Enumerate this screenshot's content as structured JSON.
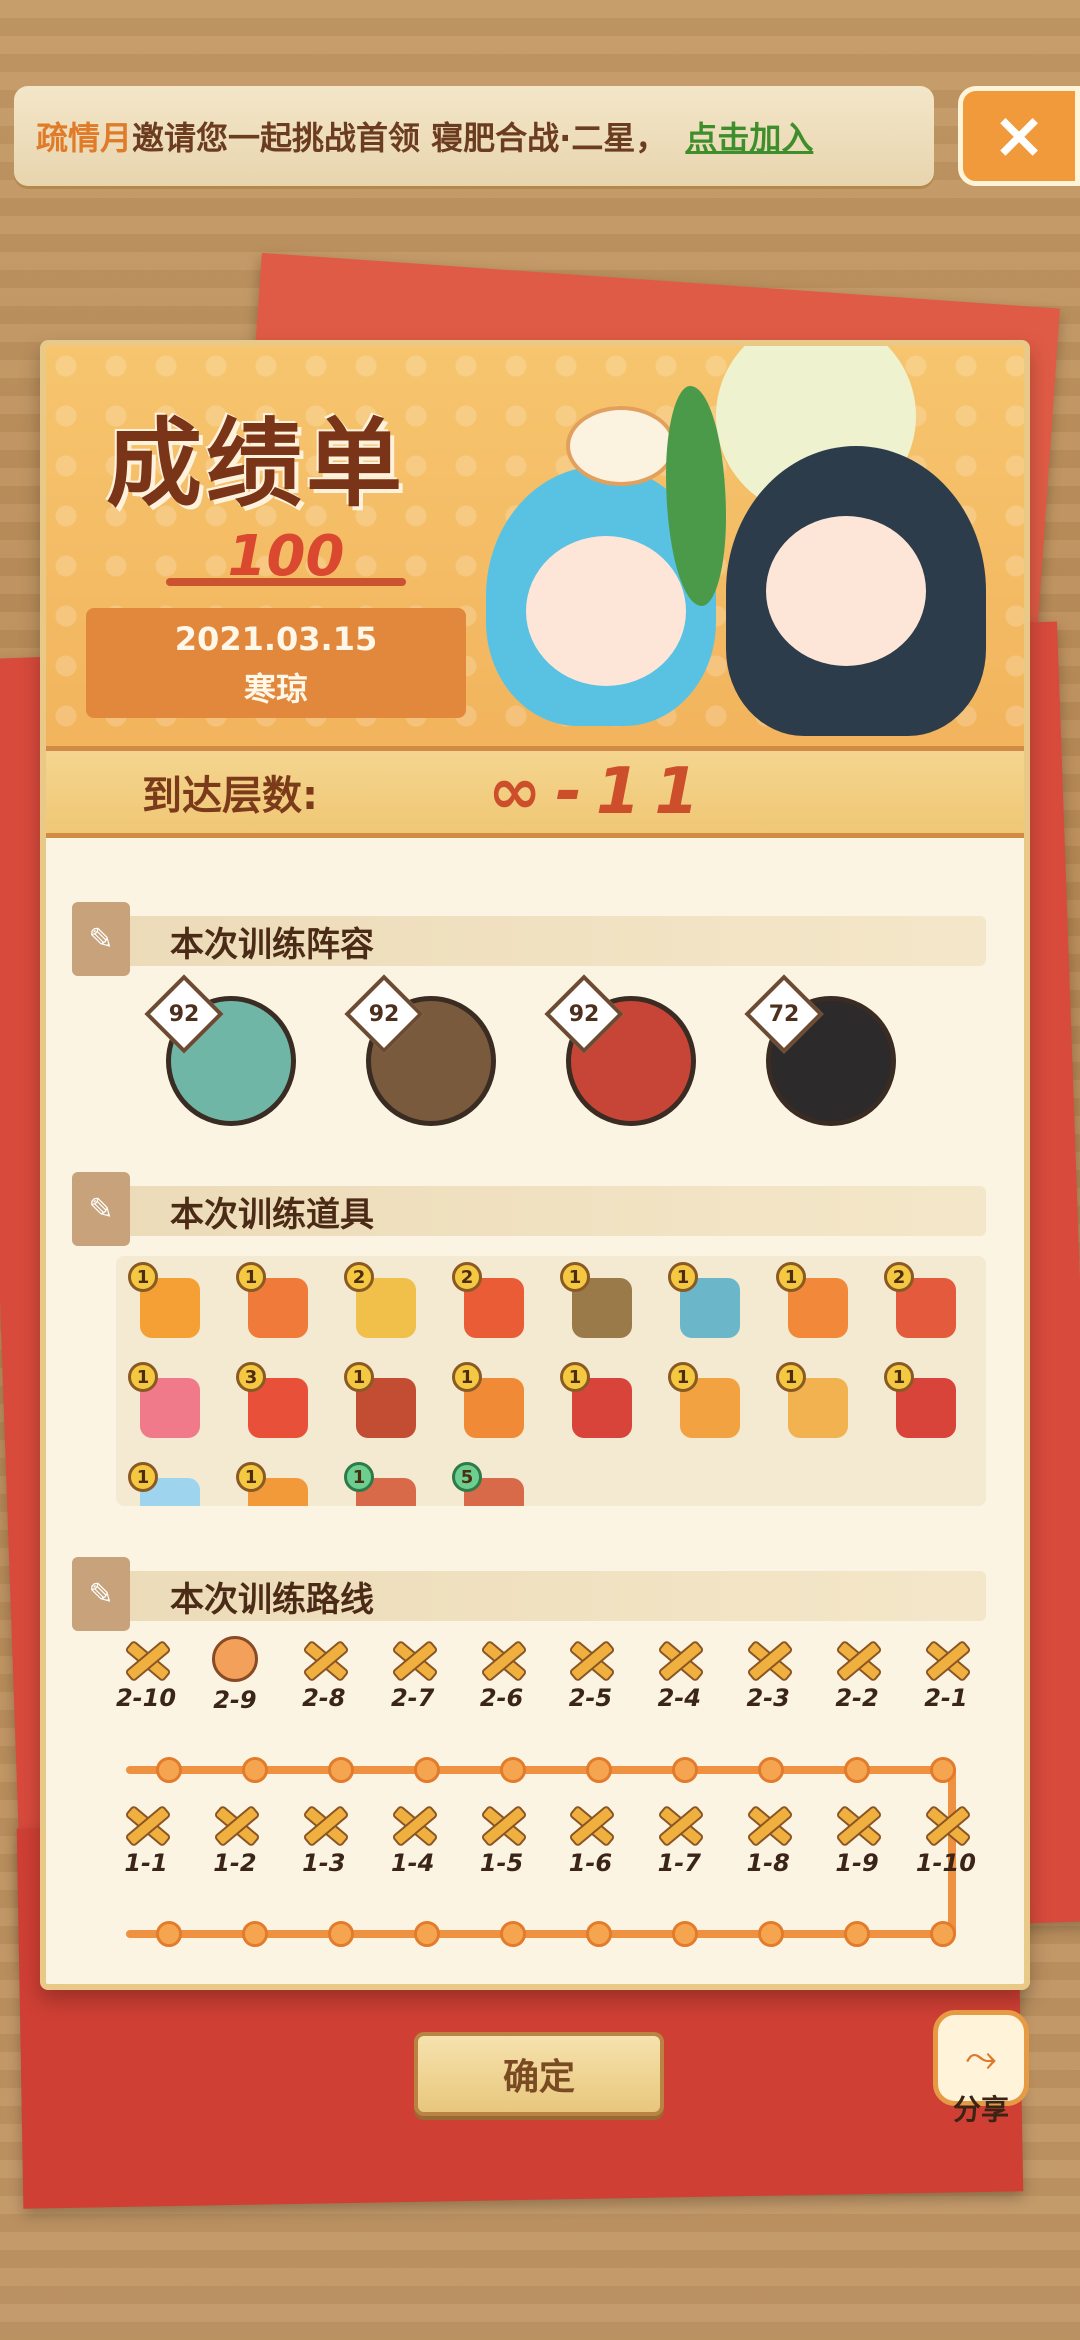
{
  "notice": {
    "inviter": "疏情月",
    "message": "邀请您一起挑战首领 寝肥合战·二星，",
    "join_label": "点击加入"
  },
  "close_icon": "×",
  "report": {
    "title": "成绩单",
    "score": "100",
    "date": "2021.03.15",
    "player_name": "寒琼"
  },
  "floor": {
    "label": "到达层数:",
    "value": "∞-11"
  },
  "team": {
    "heading": "本次训练阵容",
    "members": [
      {
        "level": "92",
        "color": "#6fb6a6"
      },
      {
        "level": "92",
        "color": "#7a5a3c"
      },
      {
        "level": "92",
        "color": "#c64536"
      },
      {
        "level": "72",
        "color": "#2c2a2a"
      }
    ]
  },
  "items": {
    "heading": "本次训练道具",
    "list": [
      {
        "count": "1",
        "color": "#f4a034"
      },
      {
        "count": "1",
        "color": "#f07a3a"
      },
      {
        "count": "2",
        "color": "#f1c04a"
      },
      {
        "count": "2",
        "color": "#e95c36"
      },
      {
        "count": "1",
        "color": "#9a7a48"
      },
      {
        "count": "1",
        "color": "#6bb7c9"
      },
      {
        "count": "1",
        "color": "#f2893a"
      },
      {
        "count": "2",
        "color": "#e45a3c"
      },
      {
        "count": "1",
        "color": "#f07a8a"
      },
      {
        "count": "3",
        "color": "#e9503a"
      },
      {
        "count": "1",
        "color": "#c24d33"
      },
      {
        "count": "1",
        "color": "#f08a36"
      },
      {
        "count": "1",
        "color": "#d8443a"
      },
      {
        "count": "1",
        "color": "#f2a240"
      },
      {
        "count": "1",
        "color": "#f2b250"
      },
      {
        "count": "1",
        "color": "#d8443a"
      },
      {
        "count": "1",
        "color": "#9fd4ef"
      },
      {
        "count": "1",
        "color": "#f29a3a"
      },
      {
        "count": "1",
        "color": "#d86a4a",
        "green": true
      },
      {
        "count": "5",
        "color": "#d86a4a",
        "green": true
      }
    ]
  },
  "route": {
    "heading": "本次训练路线",
    "top_row": [
      "2-10",
      "2-9",
      "2-8",
      "2-7",
      "2-6",
      "2-5",
      "2-4",
      "2-3",
      "2-2",
      "2-1"
    ],
    "bottom_row": [
      "1-1",
      "1-2",
      "1-3",
      "1-4",
      "1-5",
      "1-6",
      "1-7",
      "1-8",
      "1-9",
      "1-10"
    ]
  },
  "buttons": {
    "confirm": "确定",
    "share": "分享"
  }
}
